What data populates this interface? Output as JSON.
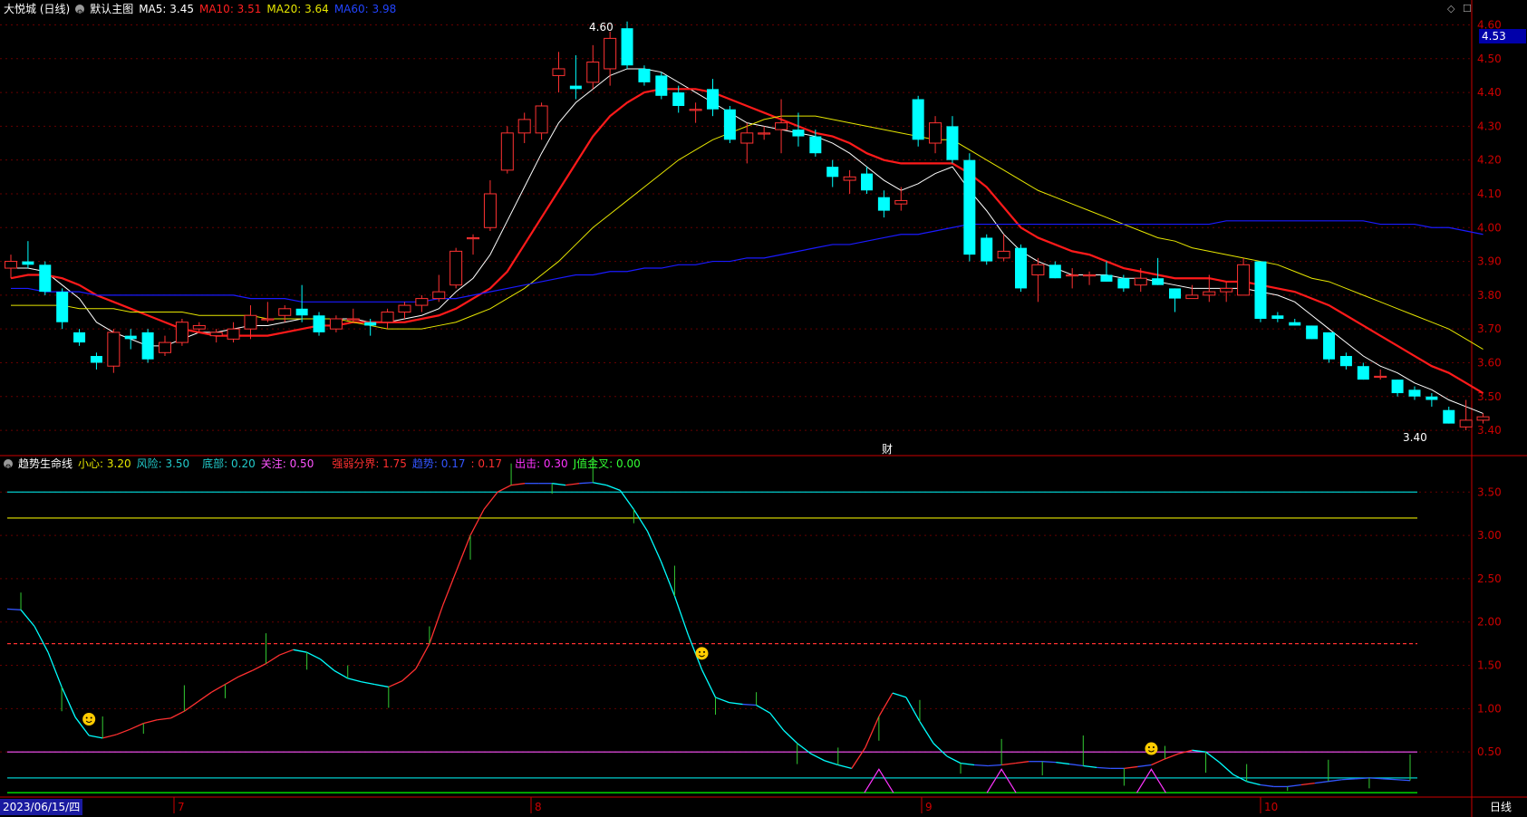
{
  "main_header": {
    "title": "大悦城 (日线)",
    "template": "默认主图",
    "ma5": "MA5: 3.45",
    "ma10": "MA10: 3.51",
    "ma20": "MA20: 3.64",
    "ma60": "MA60: 3.98"
  },
  "sub_header": {
    "title": "趋势生命线",
    "items": [
      "小心: 3.20",
      "风险: 3.50",
      "底部: 0.20",
      "关注: 0.50",
      "强弱分界: 1.75",
      "趋势: 0.17",
      ": 0.17",
      "出击: 0.30",
      "J值金叉: 0.00"
    ]
  },
  "colors": {
    "up": "#ff3232",
    "down": "#00ffff",
    "ma5": "#ffffff",
    "ma10": "#ff1a1a",
    "ma20": "#e6e600",
    "ma60": "#1a1aff",
    "axis": "#cc0000",
    "grid": "#660000",
    "xiaoxin": "#e6e600",
    "fengxian": "#00cccc",
    "dibu": "#00cccc",
    "guanzhu": "#ff55ff",
    "qiangruo": "#ff3030",
    "chuji": "#ff33ff",
    "jzhi": "#00ff00"
  },
  "current_price": "4.53",
  "high_label": "4.60",
  "low_label": "3.40",
  "cai_label": "财",
  "date_label": "2023/06/15/四",
  "period_label": "日线",
  "month_labels": [
    "7",
    "8",
    "9",
    "10"
  ],
  "chart_data": [
    {
      "type": "candlestick",
      "title": "大悦城 (日线)",
      "y_axis_ticks": [
        3.4,
        3.5,
        3.6,
        3.7,
        3.8,
        3.9,
        4.0,
        4.1,
        4.2,
        4.3,
        4.4,
        4.5,
        4.6
      ],
      "ylim": [
        3.36,
        4.62
      ],
      "ohlc": [
        [
          3.88,
          3.92,
          3.85,
          3.9
        ],
        [
          3.9,
          3.96,
          3.88,
          3.89
        ],
        [
          3.89,
          3.9,
          3.8,
          3.81
        ],
        [
          3.81,
          3.82,
          3.7,
          3.72
        ],
        [
          3.69,
          3.7,
          3.65,
          3.66
        ],
        [
          3.62,
          3.63,
          3.58,
          3.6
        ],
        [
          3.59,
          3.7,
          3.57,
          3.69
        ],
        [
          3.68,
          3.7,
          3.64,
          3.67
        ],
        [
          3.69,
          3.7,
          3.6,
          3.61
        ],
        [
          3.63,
          3.68,
          3.62,
          3.66
        ],
        [
          3.66,
          3.73,
          3.65,
          3.72
        ],
        [
          3.7,
          3.72,
          3.69,
          3.71
        ],
        [
          3.68,
          3.7,
          3.66,
          3.69
        ],
        [
          3.67,
          3.72,
          3.66,
          3.7
        ],
        [
          3.7,
          3.77,
          3.67,
          3.74
        ],
        [
          3.73,
          3.78,
          3.72,
          3.73
        ],
        [
          3.74,
          3.77,
          3.72,
          3.76
        ],
        [
          3.76,
          3.83,
          3.72,
          3.74
        ],
        [
          3.74,
          3.75,
          3.68,
          3.69
        ],
        [
          3.7,
          3.74,
          3.69,
          3.73
        ],
        [
          3.73,
          3.76,
          3.72,
          3.73
        ],
        [
          3.72,
          3.73,
          3.68,
          3.71
        ],
        [
          3.72,
          3.76,
          3.7,
          3.75
        ],
        [
          3.75,
          3.78,
          3.73,
          3.77
        ],
        [
          3.77,
          3.8,
          3.75,
          3.79
        ],
        [
          3.79,
          3.86,
          3.78,
          3.81
        ],
        [
          3.83,
          3.94,
          3.82,
          3.93
        ],
        [
          3.97,
          3.98,
          3.92,
          3.97
        ],
        [
          4.0,
          4.14,
          3.99,
          4.1
        ],
        [
          4.17,
          4.3,
          4.16,
          4.28
        ],
        [
          4.28,
          4.34,
          4.25,
          4.32
        ],
        [
          4.28,
          4.37,
          4.26,
          4.36
        ],
        [
          4.45,
          4.52,
          4.4,
          4.47
        ],
        [
          4.42,
          4.51,
          4.38,
          4.41
        ],
        [
          4.43,
          4.54,
          4.41,
          4.49
        ],
        [
          4.47,
          4.58,
          4.42,
          4.56
        ],
        [
          4.59,
          4.61,
          4.47,
          4.48
        ],
        [
          4.47,
          4.48,
          4.42,
          4.43
        ],
        [
          4.45,
          4.46,
          4.38,
          4.39
        ],
        [
          4.4,
          4.42,
          4.34,
          4.36
        ],
        [
          4.35,
          4.37,
          4.31,
          4.35
        ],
        [
          4.41,
          4.44,
          4.33,
          4.35
        ],
        [
          4.35,
          4.36,
          4.25,
          4.26
        ],
        [
          4.25,
          4.31,
          4.19,
          4.28
        ],
        [
          4.28,
          4.3,
          4.26,
          4.28
        ],
        [
          4.29,
          4.38,
          4.22,
          4.31
        ],
        [
          4.29,
          4.34,
          4.24,
          4.27
        ],
        [
          4.27,
          4.29,
          4.21,
          4.22
        ],
        [
          4.18,
          4.2,
          4.12,
          4.15
        ],
        [
          4.14,
          4.17,
          4.1,
          4.15
        ],
        [
          4.16,
          4.18,
          4.1,
          4.11
        ],
        [
          4.09,
          4.11,
          4.03,
          4.05
        ],
        [
          4.07,
          4.12,
          4.05,
          4.08
        ],
        [
          4.38,
          4.39,
          4.24,
          4.26
        ],
        [
          4.25,
          4.33,
          4.22,
          4.31
        ],
        [
          4.3,
          4.33,
          4.19,
          4.2
        ],
        [
          4.2,
          4.22,
          3.9,
          3.92
        ],
        [
          3.97,
          3.98,
          3.89,
          3.9
        ],
        [
          3.91,
          3.98,
          3.9,
          3.93
        ],
        [
          3.94,
          3.95,
          3.81,
          3.82
        ],
        [
          3.86,
          3.91,
          3.78,
          3.89
        ],
        [
          3.89,
          3.9,
          3.85,
          3.85
        ],
        [
          3.86,
          3.88,
          3.82,
          3.86
        ],
        [
          3.86,
          3.87,
          3.83,
          3.86
        ],
        [
          3.86,
          3.9,
          3.84,
          3.84
        ],
        [
          3.85,
          3.86,
          3.81,
          3.82
        ],
        [
          3.83,
          3.88,
          3.81,
          3.85
        ],
        [
          3.85,
          3.91,
          3.83,
          3.83
        ],
        [
          3.82,
          3.82,
          3.75,
          3.79
        ],
        [
          3.79,
          3.83,
          3.79,
          3.8
        ],
        [
          3.8,
          3.86,
          3.78,
          3.81
        ],
        [
          3.81,
          3.84,
          3.78,
          3.82
        ],
        [
          3.8,
          3.91,
          3.8,
          3.89
        ],
        [
          3.9,
          3.9,
          3.72,
          3.73
        ],
        [
          3.74,
          3.75,
          3.72,
          3.73
        ],
        [
          3.72,
          3.73,
          3.71,
          3.71
        ],
        [
          3.71,
          3.71,
          3.67,
          3.67
        ],
        [
          3.69,
          3.69,
          3.6,
          3.61
        ],
        [
          3.62,
          3.63,
          3.58,
          3.59
        ],
        [
          3.59,
          3.6,
          3.55,
          3.55
        ],
        [
          3.56,
          3.58,
          3.55,
          3.56
        ],
        [
          3.55,
          3.55,
          3.5,
          3.51
        ],
        [
          3.52,
          3.53,
          3.49,
          3.5
        ],
        [
          3.5,
          3.51,
          3.47,
          3.49
        ],
        [
          3.46,
          3.47,
          3.42,
          3.42
        ],
        [
          3.41,
          3.49,
          3.4,
          3.43
        ],
        [
          3.43,
          3.45,
          3.42,
          3.44
        ]
      ],
      "ma_series": [
        {
          "name": "MA5",
          "values": [
            3.88,
            3.88,
            3.87,
            3.83,
            3.79,
            3.72,
            3.69,
            3.67,
            3.65,
            3.65,
            3.67,
            3.69,
            3.69,
            3.7,
            3.71,
            3.71,
            3.72,
            3.73,
            3.73,
            3.73,
            3.73,
            3.72,
            3.72,
            3.73,
            3.74,
            3.76,
            3.81,
            3.85,
            3.92,
            4.02,
            4.12,
            4.22,
            4.31,
            4.37,
            4.41,
            4.45,
            4.47,
            4.47,
            4.46,
            4.43,
            4.4,
            4.37,
            4.34,
            4.31,
            4.3,
            4.29,
            4.28,
            4.27,
            4.25,
            4.22,
            4.18,
            4.14,
            4.11,
            4.13,
            4.16,
            4.18,
            4.11,
            4.05,
            3.98,
            3.93,
            3.9,
            3.88,
            3.86,
            3.86,
            3.86,
            3.85,
            3.85,
            3.84,
            3.83,
            3.82,
            3.82,
            3.82,
            3.82,
            3.81,
            3.8,
            3.78,
            3.74,
            3.7,
            3.66,
            3.62,
            3.59,
            3.57,
            3.54,
            3.52,
            3.49,
            3.47,
            3.45
          ]
        },
        {
          "name": "MA10",
          "values": [
            3.85,
            3.86,
            3.86,
            3.85,
            3.83,
            3.8,
            3.78,
            3.76,
            3.74,
            3.72,
            3.7,
            3.69,
            3.68,
            3.68,
            3.68,
            3.68,
            3.69,
            3.7,
            3.71,
            3.71,
            3.72,
            3.72,
            3.72,
            3.72,
            3.73,
            3.74,
            3.76,
            3.79,
            3.82,
            3.87,
            3.95,
            4.03,
            4.11,
            4.19,
            4.27,
            4.33,
            4.37,
            4.4,
            4.41,
            4.41,
            4.41,
            4.4,
            4.38,
            4.36,
            4.34,
            4.32,
            4.3,
            4.28,
            4.27,
            4.25,
            4.22,
            4.2,
            4.19,
            4.19,
            4.19,
            4.19,
            4.16,
            4.12,
            4.06,
            4.0,
            3.97,
            3.95,
            3.93,
            3.92,
            3.9,
            3.88,
            3.87,
            3.86,
            3.85,
            3.85,
            3.85,
            3.84,
            3.84,
            3.83,
            3.82,
            3.81,
            3.79,
            3.77,
            3.74,
            3.71,
            3.68,
            3.65,
            3.62,
            3.59,
            3.57,
            3.54,
            3.51
          ]
        },
        {
          "name": "MA20",
          "values": [
            3.77,
            3.77,
            3.77,
            3.77,
            3.76,
            3.76,
            3.76,
            3.75,
            3.75,
            3.75,
            3.75,
            3.74,
            3.74,
            3.74,
            3.74,
            3.73,
            3.73,
            3.73,
            3.73,
            3.73,
            3.72,
            3.71,
            3.7,
            3.7,
            3.7,
            3.71,
            3.72,
            3.74,
            3.76,
            3.79,
            3.82,
            3.86,
            3.9,
            3.95,
            4.0,
            4.04,
            4.08,
            4.12,
            4.16,
            4.2,
            4.23,
            4.26,
            4.28,
            4.3,
            4.32,
            4.33,
            4.33,
            4.33,
            4.32,
            4.31,
            4.3,
            4.29,
            4.28,
            4.27,
            4.26,
            4.26,
            4.23,
            4.2,
            4.17,
            4.14,
            4.11,
            4.09,
            4.07,
            4.05,
            4.03,
            4.01,
            3.99,
            3.97,
            3.96,
            3.94,
            3.93,
            3.92,
            3.91,
            3.9,
            3.89,
            3.87,
            3.85,
            3.84,
            3.82,
            3.8,
            3.78,
            3.76,
            3.74,
            3.72,
            3.7,
            3.67,
            3.64
          ]
        },
        {
          "name": "MA60",
          "values": [
            3.82,
            3.82,
            3.81,
            3.81,
            3.81,
            3.8,
            3.8,
            3.8,
            3.8,
            3.8,
            3.8,
            3.8,
            3.8,
            3.8,
            3.79,
            3.79,
            3.79,
            3.78,
            3.78,
            3.78,
            3.78,
            3.78,
            3.78,
            3.78,
            3.78,
            3.79,
            3.79,
            3.8,
            3.81,
            3.82,
            3.83,
            3.84,
            3.85,
            3.86,
            3.86,
            3.87,
            3.87,
            3.88,
            3.88,
            3.89,
            3.89,
            3.9,
            3.9,
            3.91,
            3.91,
            3.92,
            3.93,
            3.94,
            3.95,
            3.95,
            3.96,
            3.97,
            3.98,
            3.98,
            3.99,
            4.0,
            4.01,
            4.01,
            4.01,
            4.01,
            4.01,
            4.01,
            4.01,
            4.01,
            4.01,
            4.01,
            4.01,
            4.01,
            4.01,
            4.01,
            4.01,
            4.02,
            4.02,
            4.02,
            4.02,
            4.02,
            4.02,
            4.02,
            4.02,
            4.02,
            4.01,
            4.01,
            4.01,
            4.0,
            4.0,
            3.99,
            3.98
          ]
        }
      ]
    },
    {
      "type": "line",
      "title": "趋势生命线",
      "y_axis_ticks": [
        0.5,
        1.0,
        1.5,
        2.0,
        2.5,
        3.0,
        3.5
      ],
      "ylim": [
        0.0,
        3.9
      ],
      "reference_lines": [
        {
          "name": "风险",
          "value": 3.5
        },
        {
          "name": "小心",
          "value": 3.2
        },
        {
          "name": "强弱分界",
          "value": 1.75
        },
        {
          "name": "关注",
          "value": 0.5
        },
        {
          "name": "底部",
          "value": 0.2
        },
        {
          "name": "J值金叉",
          "value": 0.03
        }
      ],
      "trend": [
        2.15,
        2.14,
        1.95,
        1.65,
        1.25,
        0.9,
        0.69,
        0.66,
        0.7,
        0.76,
        0.83,
        0.87,
        0.89,
        0.97,
        1.08,
        1.19,
        1.28,
        1.37,
        1.44,
        1.52,
        1.62,
        1.68,
        1.65,
        1.57,
        1.44,
        1.35,
        1.31,
        1.28,
        1.25,
        1.32,
        1.46,
        1.75,
        2.2,
        2.6,
        3.0,
        3.3,
        3.5,
        3.58,
        3.6,
        3.6,
        3.6,
        3.58,
        3.6,
        3.61,
        3.58,
        3.52,
        3.3,
        3.05,
        2.7,
        2.3,
        1.85,
        1.45,
        1.13,
        1.07,
        1.05,
        1.04,
        0.95,
        0.75,
        0.6,
        0.48,
        0.4,
        0.35,
        0.31,
        0.55,
        0.91,
        1.18,
        1.13,
        0.85,
        0.6,
        0.45,
        0.37,
        0.35,
        0.34,
        0.35,
        0.37,
        0.39,
        0.39,
        0.38,
        0.36,
        0.34,
        0.32,
        0.31,
        0.31,
        0.33,
        0.35,
        0.42,
        0.48,
        0.52,
        0.5,
        0.38,
        0.24,
        0.16,
        0.12,
        0.1,
        0.1,
        0.12,
        0.14,
        0.16,
        0.18,
        0.19,
        0.2,
        0.19,
        0.18,
        0.17
      ],
      "markers_up": [
        6,
        51,
        84
      ],
      "peaks": [
        64,
        73,
        84
      ]
    }
  ]
}
